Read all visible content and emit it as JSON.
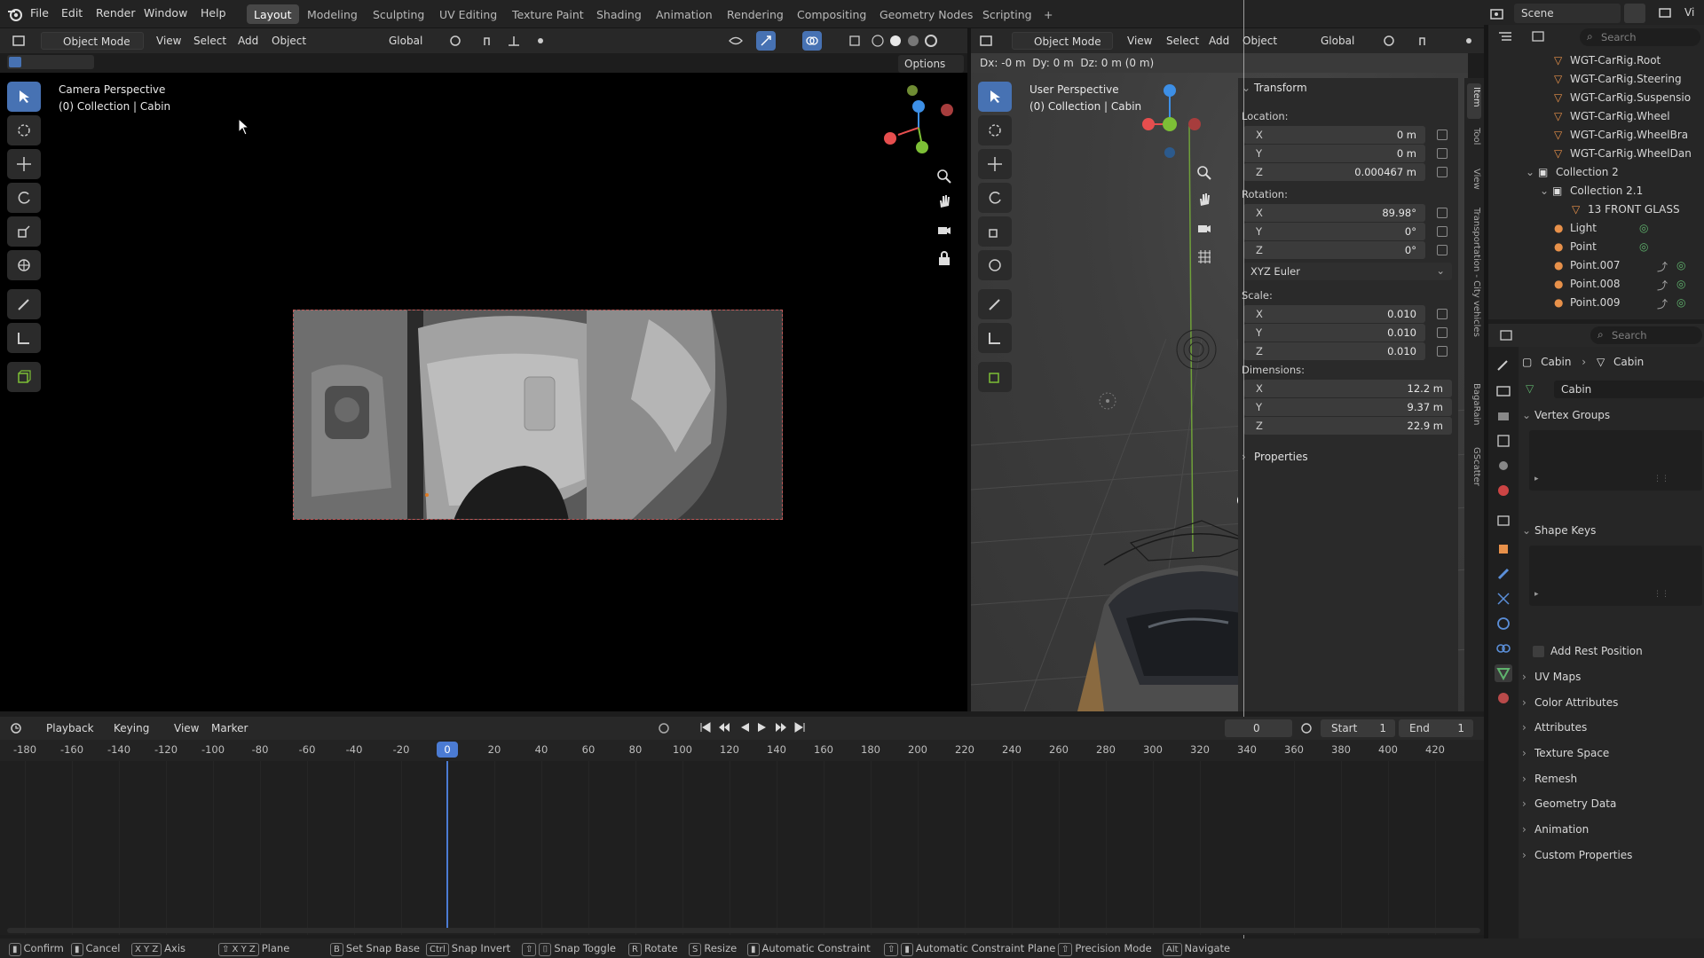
{
  "top_menu": {
    "items": [
      "File",
      "Edit",
      "Render",
      "Window",
      "Help"
    ],
    "workspaces": [
      "Layout",
      "Modeling",
      "Sculpting",
      "UV Editing",
      "Texture Paint",
      "Shading",
      "Animation",
      "Rendering",
      "Compositing",
      "Geometry Nodes",
      "Scripting"
    ],
    "active_workspace": "Layout",
    "add_tab": "+",
    "scene_label": "Scene",
    "view_layer_label": "Vi"
  },
  "left_viewport": {
    "mode": "Object Mode",
    "menus": [
      "View",
      "Select",
      "Add",
      "Object"
    ],
    "orientation": "Global",
    "options_label": "Options",
    "view_name": "Camera Perspective",
    "collection_label": "(0) Collection | Cabin"
  },
  "right_viewport": {
    "mode": "Object Mode",
    "menus": [
      "View",
      "Select",
      "Add",
      "Object"
    ],
    "orientation": "Global",
    "delta_readout": "Dx: -0 m  Dy: 0 m  Dz: 0 m (0 m)",
    "view_name": "User Perspective",
    "collection_label": "(0) Collection | Cabin"
  },
  "npanel": {
    "transform_title": "Transform",
    "location_label": "Location:",
    "location": [
      {
        "axis": "X",
        "value": "0 m"
      },
      {
        "axis": "Y",
        "value": "0 m"
      },
      {
        "axis": "Z",
        "value": "0.000467 m"
      }
    ],
    "rotation_label": "Rotation:",
    "rotation": [
      {
        "axis": "X",
        "value": "89.98°"
      },
      {
        "axis": "Y",
        "value": "0°"
      },
      {
        "axis": "Z",
        "value": "0°"
      }
    ],
    "rotation_mode": "XYZ Euler",
    "scale_label": "Scale:",
    "scale": [
      {
        "axis": "X",
        "value": "0.010"
      },
      {
        "axis": "Y",
        "value": "0.010"
      },
      {
        "axis": "Z",
        "value": "0.010"
      }
    ],
    "dimensions_label": "Dimensions:",
    "dimensions": [
      {
        "axis": "X",
        "value": "12.2 m"
      },
      {
        "axis": "Y",
        "value": "9.37 m"
      },
      {
        "axis": "Z",
        "value": "22.9 m"
      }
    ],
    "properties_label": "Properties",
    "side_tabs": [
      "Item",
      "Tool",
      "View",
      "Transportation - City vehicles",
      "BagaRain",
      "GScatter"
    ]
  },
  "outliner": {
    "search_placeholder": "Search",
    "rows": [
      {
        "label": "WGT-CarRig.Root",
        "indent": 1
      },
      {
        "label": "WGT-CarRig.Steering",
        "indent": 1
      },
      {
        "label": "WGT-CarRig.Suspensio",
        "indent": 1
      },
      {
        "label": "WGT-CarRig.Wheel",
        "indent": 1
      },
      {
        "label": "WGT-CarRig.WheelBra",
        "indent": 1
      },
      {
        "label": "WGT-CarRig.WheelDan",
        "indent": 1
      },
      {
        "label": "Collection 2",
        "indent": 0
      },
      {
        "label": "Collection 2.1",
        "indent": 1
      },
      {
        "label": "13 FRONT GLASS",
        "indent": 2
      },
      {
        "label": "Light",
        "indent": 1
      },
      {
        "label": "Point",
        "indent": 1
      },
      {
        "label": "Point.007",
        "indent": 1
      },
      {
        "label": "Point.008",
        "indent": 1
      },
      {
        "label": "Point.009",
        "indent": 1
      }
    ]
  },
  "properties": {
    "search_placeholder": "Search",
    "breadcrumb_object": "Cabin",
    "breadcrumb_data": "Cabin",
    "data_name": "Cabin",
    "sections": [
      "Vertex Groups",
      "Shape Keys"
    ],
    "add_rest_position": "Add Rest Position",
    "collapsed_sections": [
      "UV Maps",
      "Color Attributes",
      "Attributes",
      "Texture Space",
      "Remesh",
      "Geometry Data",
      "Animation",
      "Custom Properties"
    ]
  },
  "timeline": {
    "menus": [
      "Playback",
      "Keying",
      "View",
      "Marker"
    ],
    "current_frame": "0",
    "start_label": "Start",
    "start_value": "1",
    "end_label": "End",
    "end_value": "1",
    "ruler": [
      "-180",
      "-160",
      "-140",
      "-120",
      "-100",
      "-80",
      "-60",
      "-40",
      "-20",
      "0",
      "20",
      "40",
      "60",
      "80",
      "100",
      "120",
      "140",
      "160",
      "180",
      "200",
      "220",
      "240",
      "260",
      "280",
      "300",
      "320",
      "340",
      "360",
      "380",
      "400",
      "420"
    ],
    "playhead_label": "0"
  },
  "statusbar": {
    "items": [
      {
        "key": "",
        "label": "Confirm"
      },
      {
        "key": "",
        "label": "Cancel"
      },
      {
        "key": "X Y Z",
        "label": "Axis"
      },
      {
        "key": "⇧ X Y Z",
        "label": "Plane"
      },
      {
        "key": "B",
        "label": "Set Snap Base"
      },
      {
        "key": "Ctrl",
        "label": "Snap Invert"
      },
      {
        "key": "⇧",
        "label": "Snap Toggle"
      },
      {
        "key": "R",
        "label": "Rotate"
      },
      {
        "key": "S",
        "label": "Resize"
      },
      {
        "key": "",
        "label": "Automatic Constraint"
      },
      {
        "key": "⇧",
        "label": "Automatic Constraint Plane"
      },
      {
        "key": "⇧",
        "label": "Precision Mode"
      },
      {
        "key": "Alt",
        "label": "Navigate"
      }
    ]
  },
  "colors": {
    "accent": "#4772b3",
    "playhead": "#4b7bd3",
    "x_axis": "#e64e4e",
    "y_axis": "#7dbf36",
    "z_axis": "#3d8fe6",
    "object_orange": "#e8914a"
  }
}
